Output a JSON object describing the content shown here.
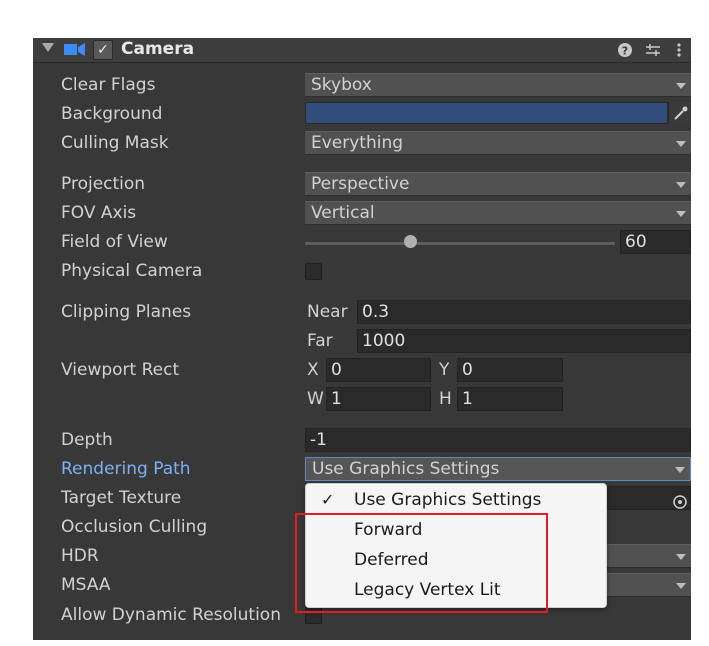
{
  "component": {
    "title": "Camera",
    "enabled_glyph": "✓",
    "icons": [
      "fold-arrow-icon",
      "camera-icon",
      "help-icon",
      "preset-sliders-icon",
      "kebab-menu-icon"
    ]
  },
  "fields": {
    "clear_flags": {
      "label": "Clear Flags",
      "value": "Skybox"
    },
    "background": {
      "label": "Background",
      "color": "#314d79"
    },
    "culling_mask": {
      "label": "Culling Mask",
      "value": "Everything"
    },
    "projection": {
      "label": "Projection",
      "value": "Perspective"
    },
    "fov_axis": {
      "label": "FOV Axis",
      "value": "Vertical"
    },
    "field_of_view": {
      "label": "Field of View",
      "value": "60"
    },
    "physical_camera": {
      "label": "Physical Camera"
    },
    "clipping_planes": {
      "label": "Clipping Planes",
      "near_label": "Near",
      "near": "0.3",
      "far_label": "Far",
      "far": "1000"
    },
    "viewport_rect": {
      "label": "Viewport Rect",
      "x_label": "X",
      "x": "0",
      "y_label": "Y",
      "y": "0",
      "w_label": "W",
      "w": "1",
      "h_label": "H",
      "h": "1"
    },
    "depth": {
      "label": "Depth",
      "value": "-1"
    },
    "rendering_path": {
      "label": "Rendering Path",
      "value": "Use Graphics Settings"
    },
    "target_texture": {
      "label": "Target Texture"
    },
    "occlusion_culling": {
      "label": "Occlusion Culling"
    },
    "hdr": {
      "label": "HDR"
    },
    "msaa": {
      "label": "MSAA"
    },
    "allow_dynamic_resolution": {
      "label": "Allow Dynamic Resolution"
    }
  },
  "popup": {
    "check_glyph": "✓",
    "items": [
      {
        "label": "Use Graphics Settings"
      },
      {
        "label": "Forward"
      },
      {
        "label": "Deferred"
      },
      {
        "label": "Legacy Vertex Lit"
      }
    ]
  },
  "colors": {
    "panel_bg": "#383838",
    "accent_label": "#7fb0f7",
    "highlight": "#e02020",
    "background_color": "#314d79"
  }
}
